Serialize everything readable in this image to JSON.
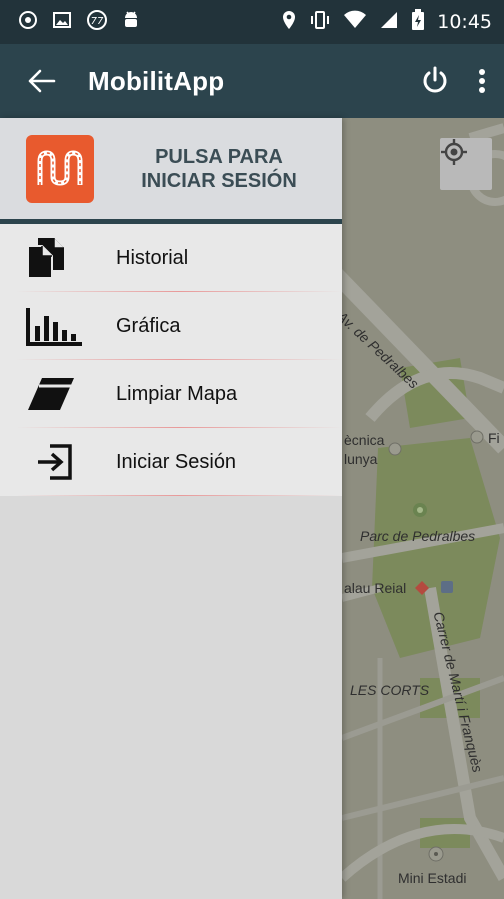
{
  "status_bar": {
    "time": "10:45",
    "left_icons": [
      "circle-icon",
      "image-icon",
      "watch-icon",
      "android-icon"
    ],
    "right_icons": [
      "location-icon",
      "vibrate-icon",
      "wifi-icon",
      "signal-icon",
      "battery-icon"
    ]
  },
  "app_bar": {
    "title": "MobilitApp",
    "icons": [
      "back-arrow-icon",
      "power-icon",
      "more-vert-icon"
    ]
  },
  "drawer": {
    "header": {
      "login_prompt": "PULSA PARA INICIAR SESIÓN",
      "logo_icon": "mobilitapp-logo"
    },
    "items": [
      {
        "label": "Historial",
        "icon": "documents-icon"
      },
      {
        "label": "Gráfica",
        "icon": "bar-chart-icon"
      },
      {
        "label": "Limpiar Mapa",
        "icon": "eraser-icon"
      },
      {
        "label": "Iniciar Sesión",
        "icon": "login-icon"
      }
    ]
  },
  "map": {
    "labels": {
      "av_pedralbes": "Av. de Pedralbes",
      "tecnica": "ècnica",
      "catalunya": "lunya",
      "fi": "Fi",
      "parc": "Parc de Pedralbes",
      "palau_reial": "alau Reial",
      "carrer": "Carrer de Martí i Franquès",
      "les_corts": "LES CORTS",
      "mini_estadi": "Mini Estadi"
    }
  },
  "colors": {
    "status_bar": "#22333a",
    "app_bar": "#2c444d",
    "logo": "#e85a2e",
    "drawer_bg": "#d9d9d9",
    "map_bg": "#8d8d80"
  }
}
